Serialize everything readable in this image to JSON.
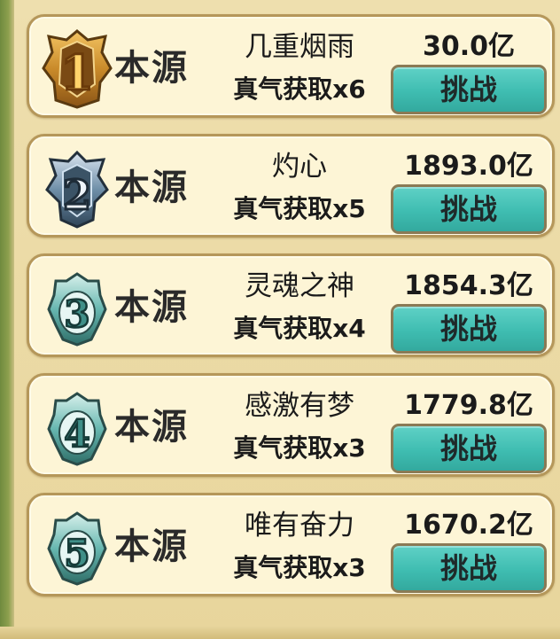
{
  "colors": {
    "button": "#3fbdb1",
    "card_bg": "#fdf5d6",
    "card_border": "#b5975a",
    "rank1_badge": "#c98a2a",
    "rank2_badge": "#6f8fa8",
    "rank3_badge": "#67b7b0"
  },
  "rankings": [
    {
      "rank": "1",
      "badge_icon": "gold-rank-badge-icon",
      "type": "本源",
      "name": "几重烟雨",
      "bonus": "真气获取x6",
      "power": "30.0亿",
      "button": "挑战"
    },
    {
      "rank": "2",
      "badge_icon": "silver-rank-badge-icon",
      "type": "本源",
      "name": "灼心",
      "bonus": "真气获取x5",
      "power": "1893.0亿",
      "button": "挑战"
    },
    {
      "rank": "3",
      "badge_icon": "jade-rank-badge-icon",
      "type": "本源",
      "name": "灵魂之神",
      "bonus": "真气获取x4",
      "power": "1854.3亿",
      "button": "挑战"
    },
    {
      "rank": "4",
      "badge_icon": "jade-rank-badge-icon",
      "type": "本源",
      "name": "感激有梦",
      "bonus": "真气获取x3",
      "power": "1779.8亿",
      "button": "挑战"
    },
    {
      "rank": "5",
      "badge_icon": "jade-rank-badge-icon",
      "type": "本源",
      "name": "唯有奋力",
      "bonus": "真气获取x3",
      "power": "1670.2亿",
      "button": "挑战"
    }
  ]
}
